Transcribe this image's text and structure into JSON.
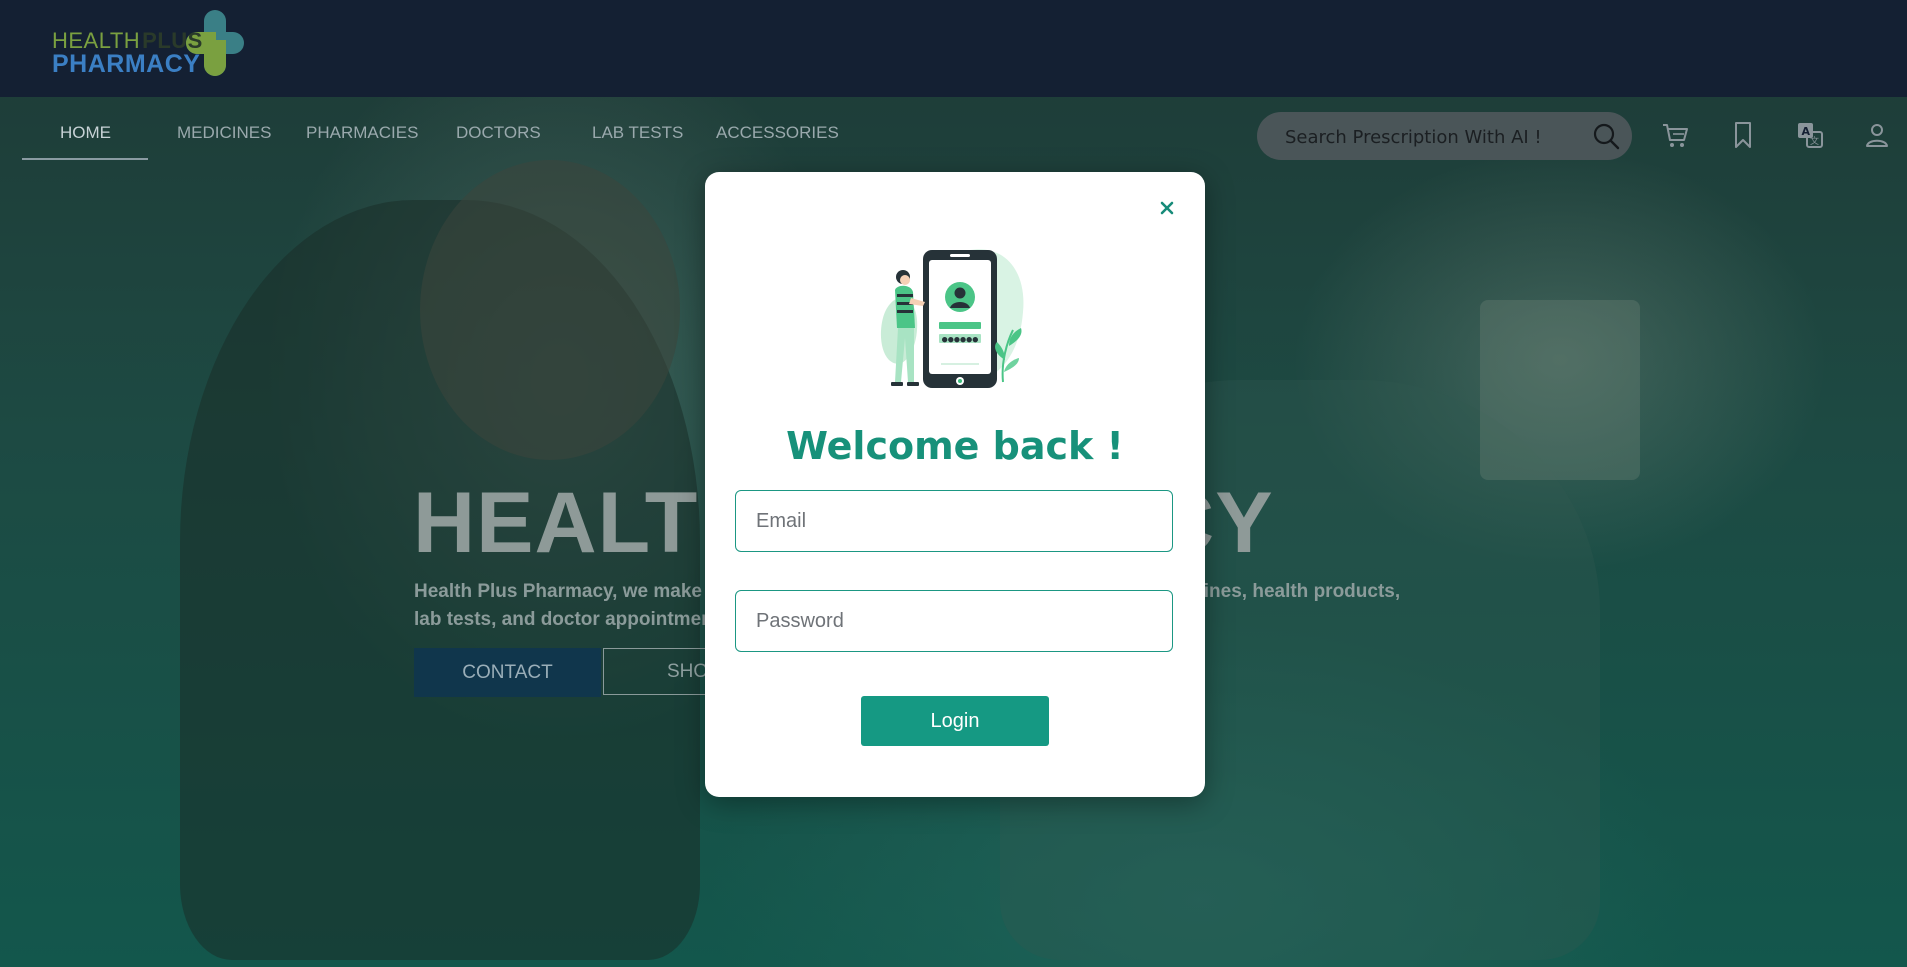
{
  "brand": {
    "line1": "HEALTH",
    "line1_plus": "PLUS",
    "line2": "PHARMACY",
    "colors": {
      "green": "#7aa040",
      "blue": "#3b7fc4",
      "teal": "#3a7f86"
    }
  },
  "nav": {
    "items": [
      {
        "label": "HOME",
        "active": true
      },
      {
        "label": "MEDICINES"
      },
      {
        "label": "PHARMACIES"
      },
      {
        "label": "DOCTORS"
      },
      {
        "label": "LAB TESTS"
      },
      {
        "label": "ACCESSORIES"
      }
    ]
  },
  "header_tools": {
    "search_placeholder": "Search Prescription With AI !",
    "icons": [
      "search-icon",
      "cart-icon",
      "bookmark-icon",
      "translate-icon",
      "user-icon"
    ]
  },
  "hero": {
    "title_left": "HEALT",
    "title_right": "RMACY",
    "desc_line1_left": "Health Plus Pharmacy, we make h",
    "desc_line1_right": "medicines, health products,",
    "desc_line2_left": "lab tests, and doctor appointmen",
    "contact_label": "CONTACT",
    "shop_label": "SHO"
  },
  "modal": {
    "title": "Welcome back !",
    "email_placeholder": "Email",
    "password_placeholder": "Password",
    "login_label": "Login",
    "accent_color": "#159983"
  }
}
